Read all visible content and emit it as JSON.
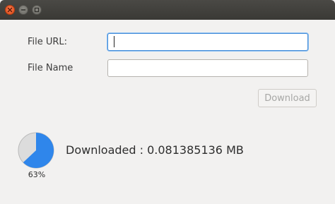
{
  "window": {
    "controls": [
      "close-icon",
      "minimize-icon",
      "maximize-icon"
    ]
  },
  "form": {
    "url_label": "File URL:",
    "url_value": "",
    "name_label": "File Name",
    "name_value": ""
  },
  "actions": {
    "download_label": "Download"
  },
  "progress": {
    "fraction": 0.63,
    "percent_label": "63%",
    "status_text": "Downloaded : 0.081385136 MB"
  },
  "colors": {
    "progress_fill": "#2f86eb",
    "progress_track": "#dcdcdc",
    "focus_border": "#4a90d9",
    "close_button": "#df4b16"
  }
}
